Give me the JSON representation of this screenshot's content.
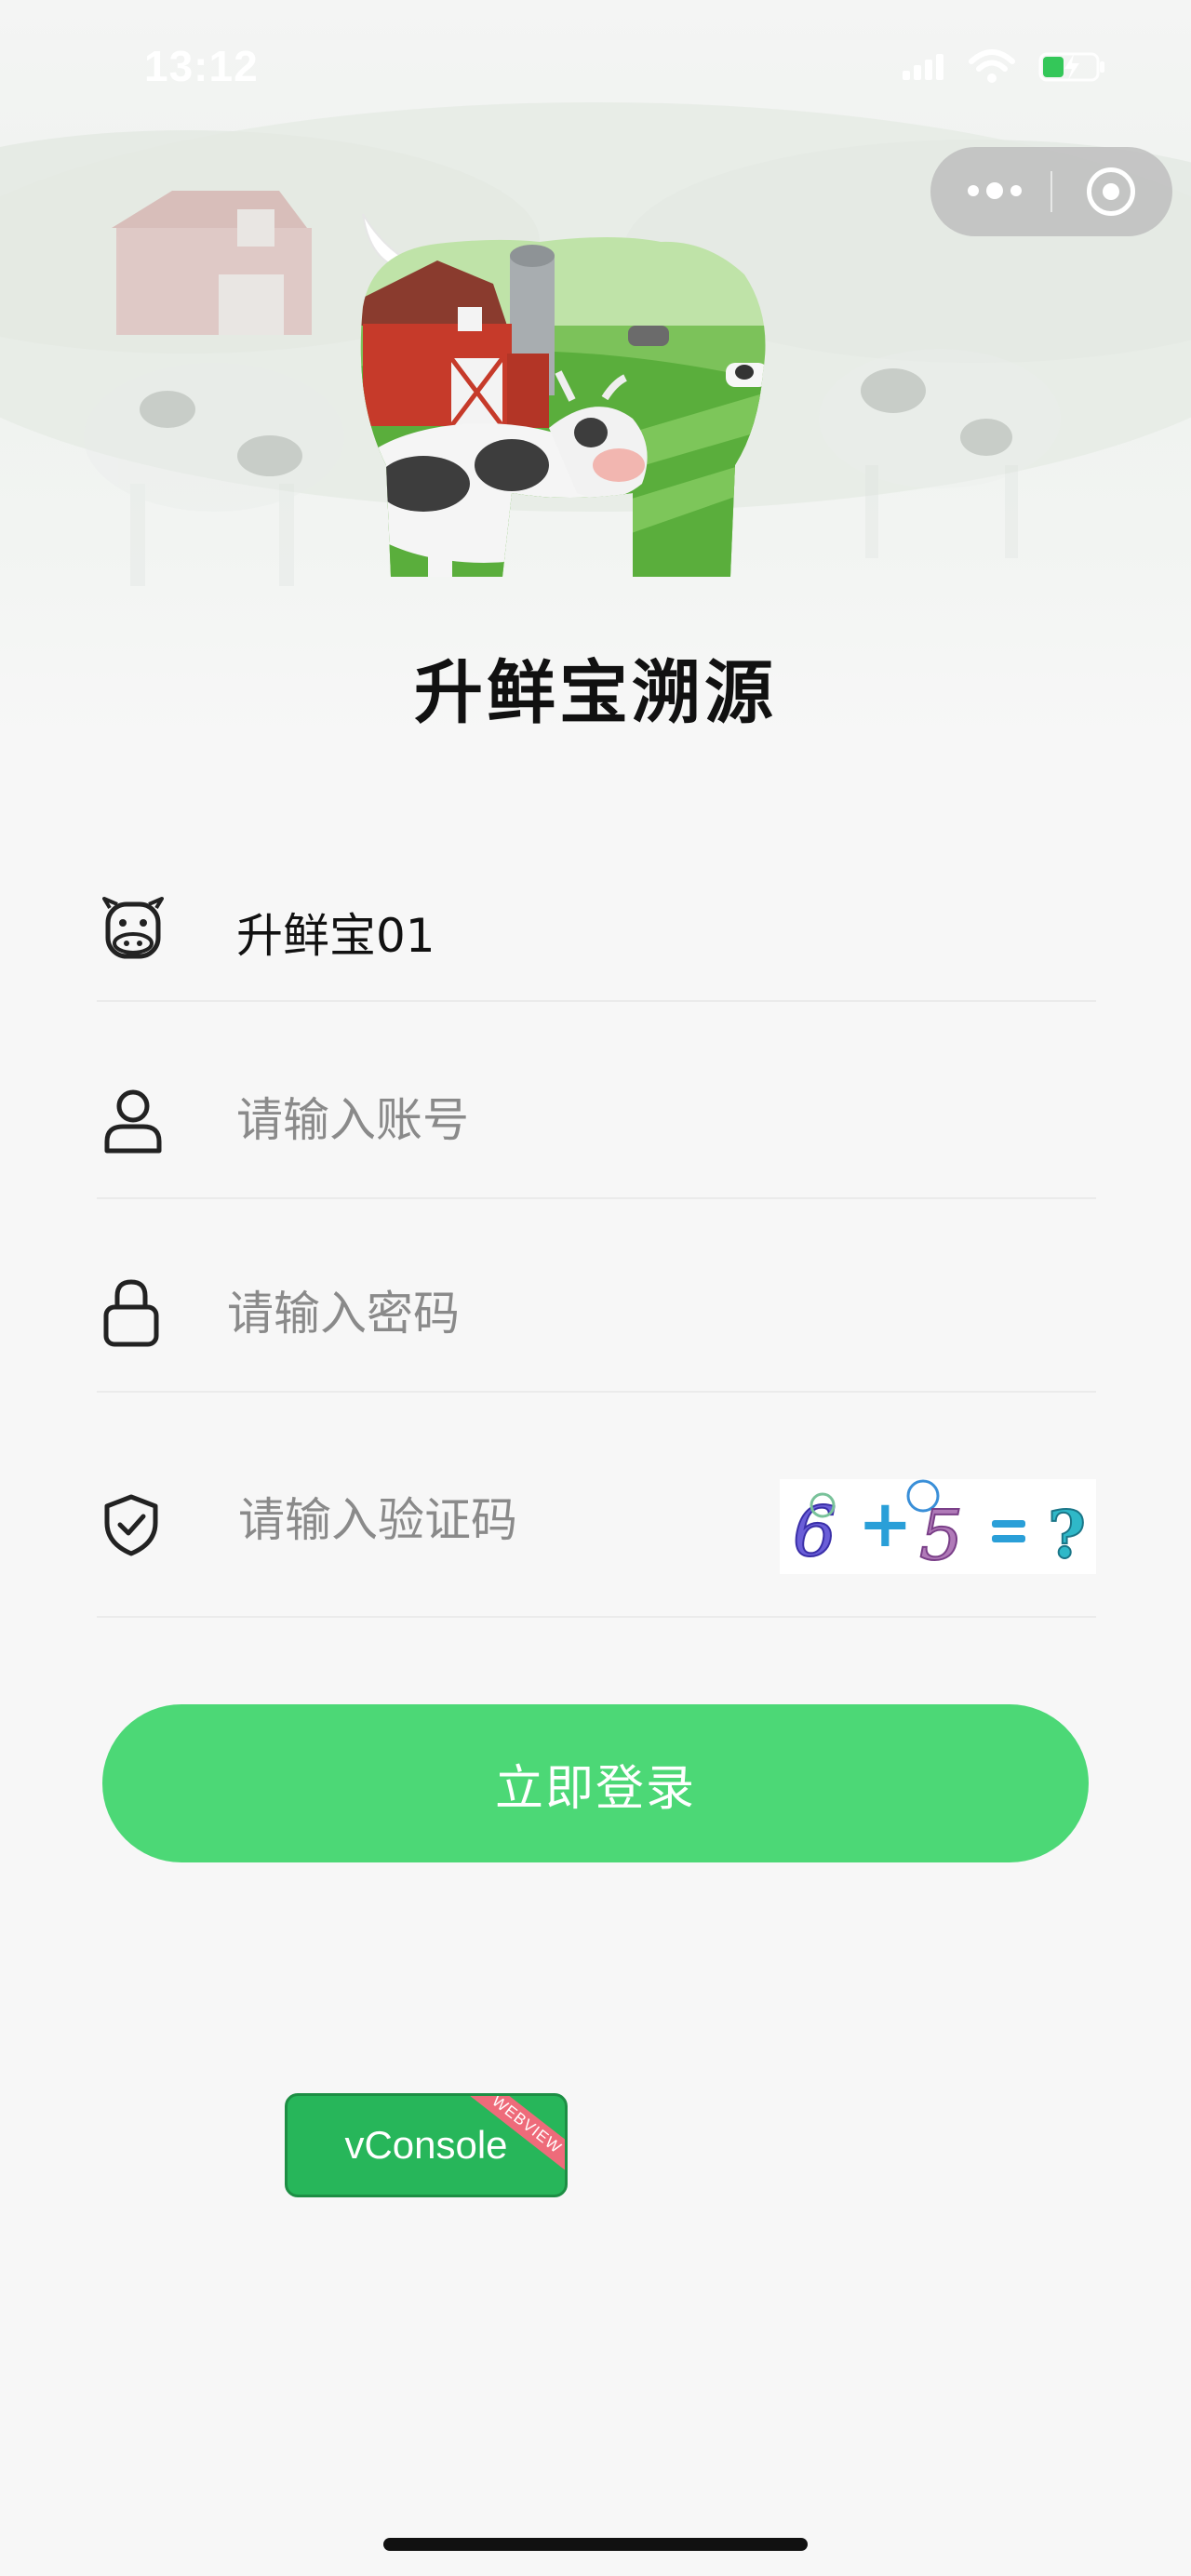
{
  "status_bar": {
    "time": "13:12",
    "icons": [
      "signal-icon",
      "wifi-icon",
      "battery-charging-icon"
    ]
  },
  "capsule": {
    "icons": [
      "more-icon",
      "close-circle-icon"
    ]
  },
  "app": {
    "title": "升鲜宝溯源"
  },
  "form": {
    "tenant": {
      "icon": "cow-icon",
      "value": "升鲜宝01"
    },
    "account": {
      "icon": "user-icon",
      "placeholder": "请输入账号"
    },
    "password": {
      "icon": "lock-icon",
      "placeholder": "请输入密码"
    },
    "captcha": {
      "icon": "shield-check-icon",
      "placeholder": "请输入验证码",
      "image_text": "6+5=?"
    }
  },
  "login_button": {
    "label": "立即登录"
  },
  "vconsole": {
    "label": "vConsole",
    "ribbon": "WEBVIEW"
  },
  "colors": {
    "primary": "#4cd876",
    "vconsole": "#27b65a",
    "placeholder": "#8c8c8c",
    "background": "#f7f7f7"
  }
}
